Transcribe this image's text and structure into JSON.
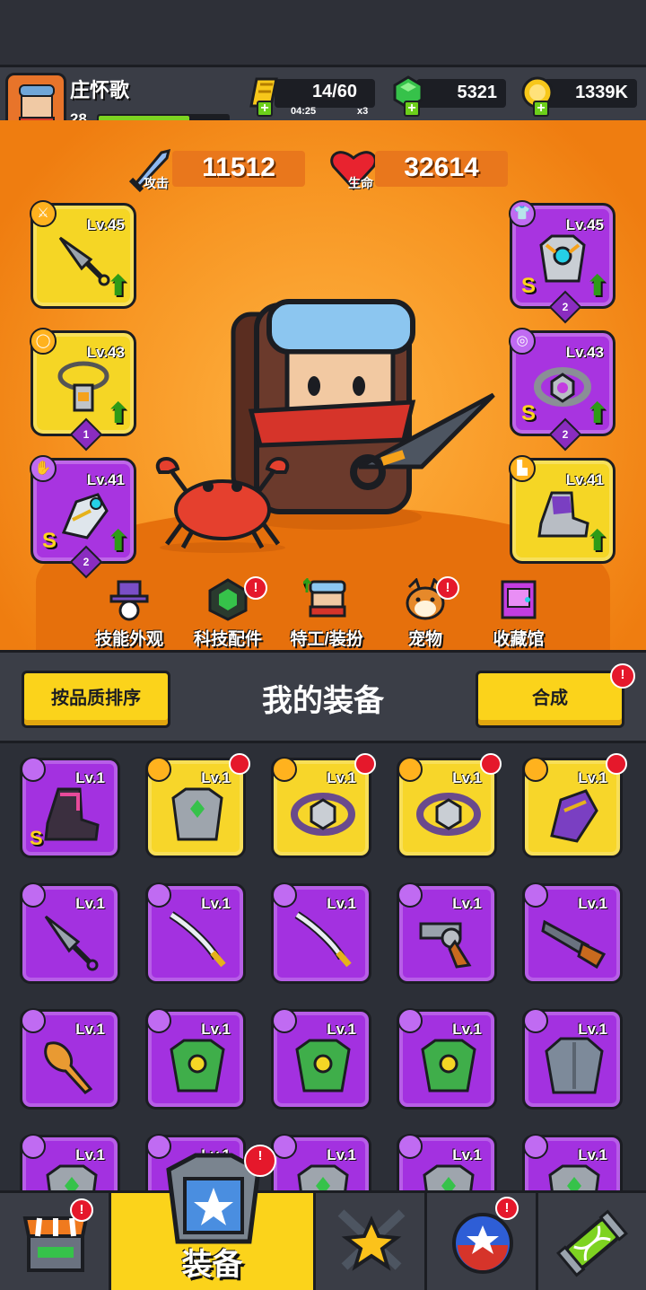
{
  "player": {
    "name": "庄怀歌",
    "level": "28",
    "xp_fraction": 0.7
  },
  "resources": {
    "energy": {
      "value": "14/60",
      "timer": "04:25",
      "multiplier": "x3"
    },
    "gems": {
      "value": "5321"
    },
    "coins": {
      "value": "1339K"
    }
  },
  "stats": {
    "attack": {
      "label": "攻击",
      "value": "11512"
    },
    "hp": {
      "label": "生命",
      "value": "32614"
    }
  },
  "equipped": {
    "left": [
      {
        "slot": "weapon",
        "level": "Lv.45"
      },
      {
        "slot": "necklace",
        "level": "Lv.43",
        "stars": "1"
      },
      {
        "slot": "gloves",
        "level": "Lv.41",
        "rank": "S",
        "stars": "2"
      }
    ],
    "right": [
      {
        "slot": "armor",
        "level": "Lv.45",
        "rank": "S",
        "stars": "2"
      },
      {
        "slot": "belt",
        "level": "Lv.43",
        "rank": "S",
        "stars": "2"
      },
      {
        "slot": "boots",
        "level": "Lv.41"
      }
    ]
  },
  "nav": [
    {
      "label": "技能外观"
    },
    {
      "label": "科技配件"
    },
    {
      "label": "特工/装扮"
    },
    {
      "label": "宠物"
    },
    {
      "label": "收藏馆"
    }
  ],
  "inventory": {
    "title": "我的装备",
    "sort_button": "按品质排序",
    "merge_button": "合成",
    "rows": [
      [
        {
          "type": "boots",
          "level": "Lv.1",
          "rarity": "purple",
          "rank": "S"
        },
        {
          "type": "armor",
          "level": "Lv.1",
          "rarity": "gold"
        },
        {
          "type": "belt",
          "level": "Lv.1",
          "rarity": "gold"
        },
        {
          "type": "belt",
          "level": "Lv.1",
          "rarity": "gold"
        },
        {
          "type": "gloves",
          "level": "Lv.1",
          "rarity": "gold"
        }
      ],
      [
        {
          "type": "kunai",
          "level": "Lv.1",
          "rarity": "purple"
        },
        {
          "type": "katana",
          "level": "Lv.1",
          "rarity": "purple"
        },
        {
          "type": "katana",
          "level": "Lv.1",
          "rarity": "purple"
        },
        {
          "type": "revolver",
          "level": "Lv.1",
          "rarity": "purple"
        },
        {
          "type": "shotgun",
          "level": "Lv.1",
          "rarity": "purple"
        }
      ],
      [
        {
          "type": "bat",
          "level": "Lv.1",
          "rarity": "purple"
        },
        {
          "type": "leaf-armor",
          "level": "Lv.1",
          "rarity": "purple"
        },
        {
          "type": "leaf-armor",
          "level": "Lv.1",
          "rarity": "purple"
        },
        {
          "type": "leaf-armor",
          "level": "Lv.1",
          "rarity": "purple"
        },
        {
          "type": "plate-armor",
          "level": "Lv.1",
          "rarity": "purple"
        }
      ],
      [
        {
          "type": "armor",
          "level": "Lv.1",
          "rarity": "purple"
        },
        {
          "type": "armor",
          "level": "Lv.1",
          "rarity": "purple"
        },
        {
          "type": "armor",
          "level": "Lv.1",
          "rarity": "purple"
        },
        {
          "type": "armor",
          "level": "Lv.1",
          "rarity": "purple"
        },
        {
          "type": "armor",
          "level": "Lv.1",
          "rarity": "purple"
        }
      ]
    ]
  },
  "bottom_nav": [
    {
      "id": "shop"
    },
    {
      "id": "equipment",
      "label": "装备"
    },
    {
      "id": "battle"
    },
    {
      "id": "talents"
    },
    {
      "id": "lab"
    }
  ],
  "colors": {
    "gold": "#f7d62a",
    "purple": "#a331e0",
    "orange": "#f48b18",
    "alert": "#e5182b",
    "upgrade": "#2e9b17"
  }
}
